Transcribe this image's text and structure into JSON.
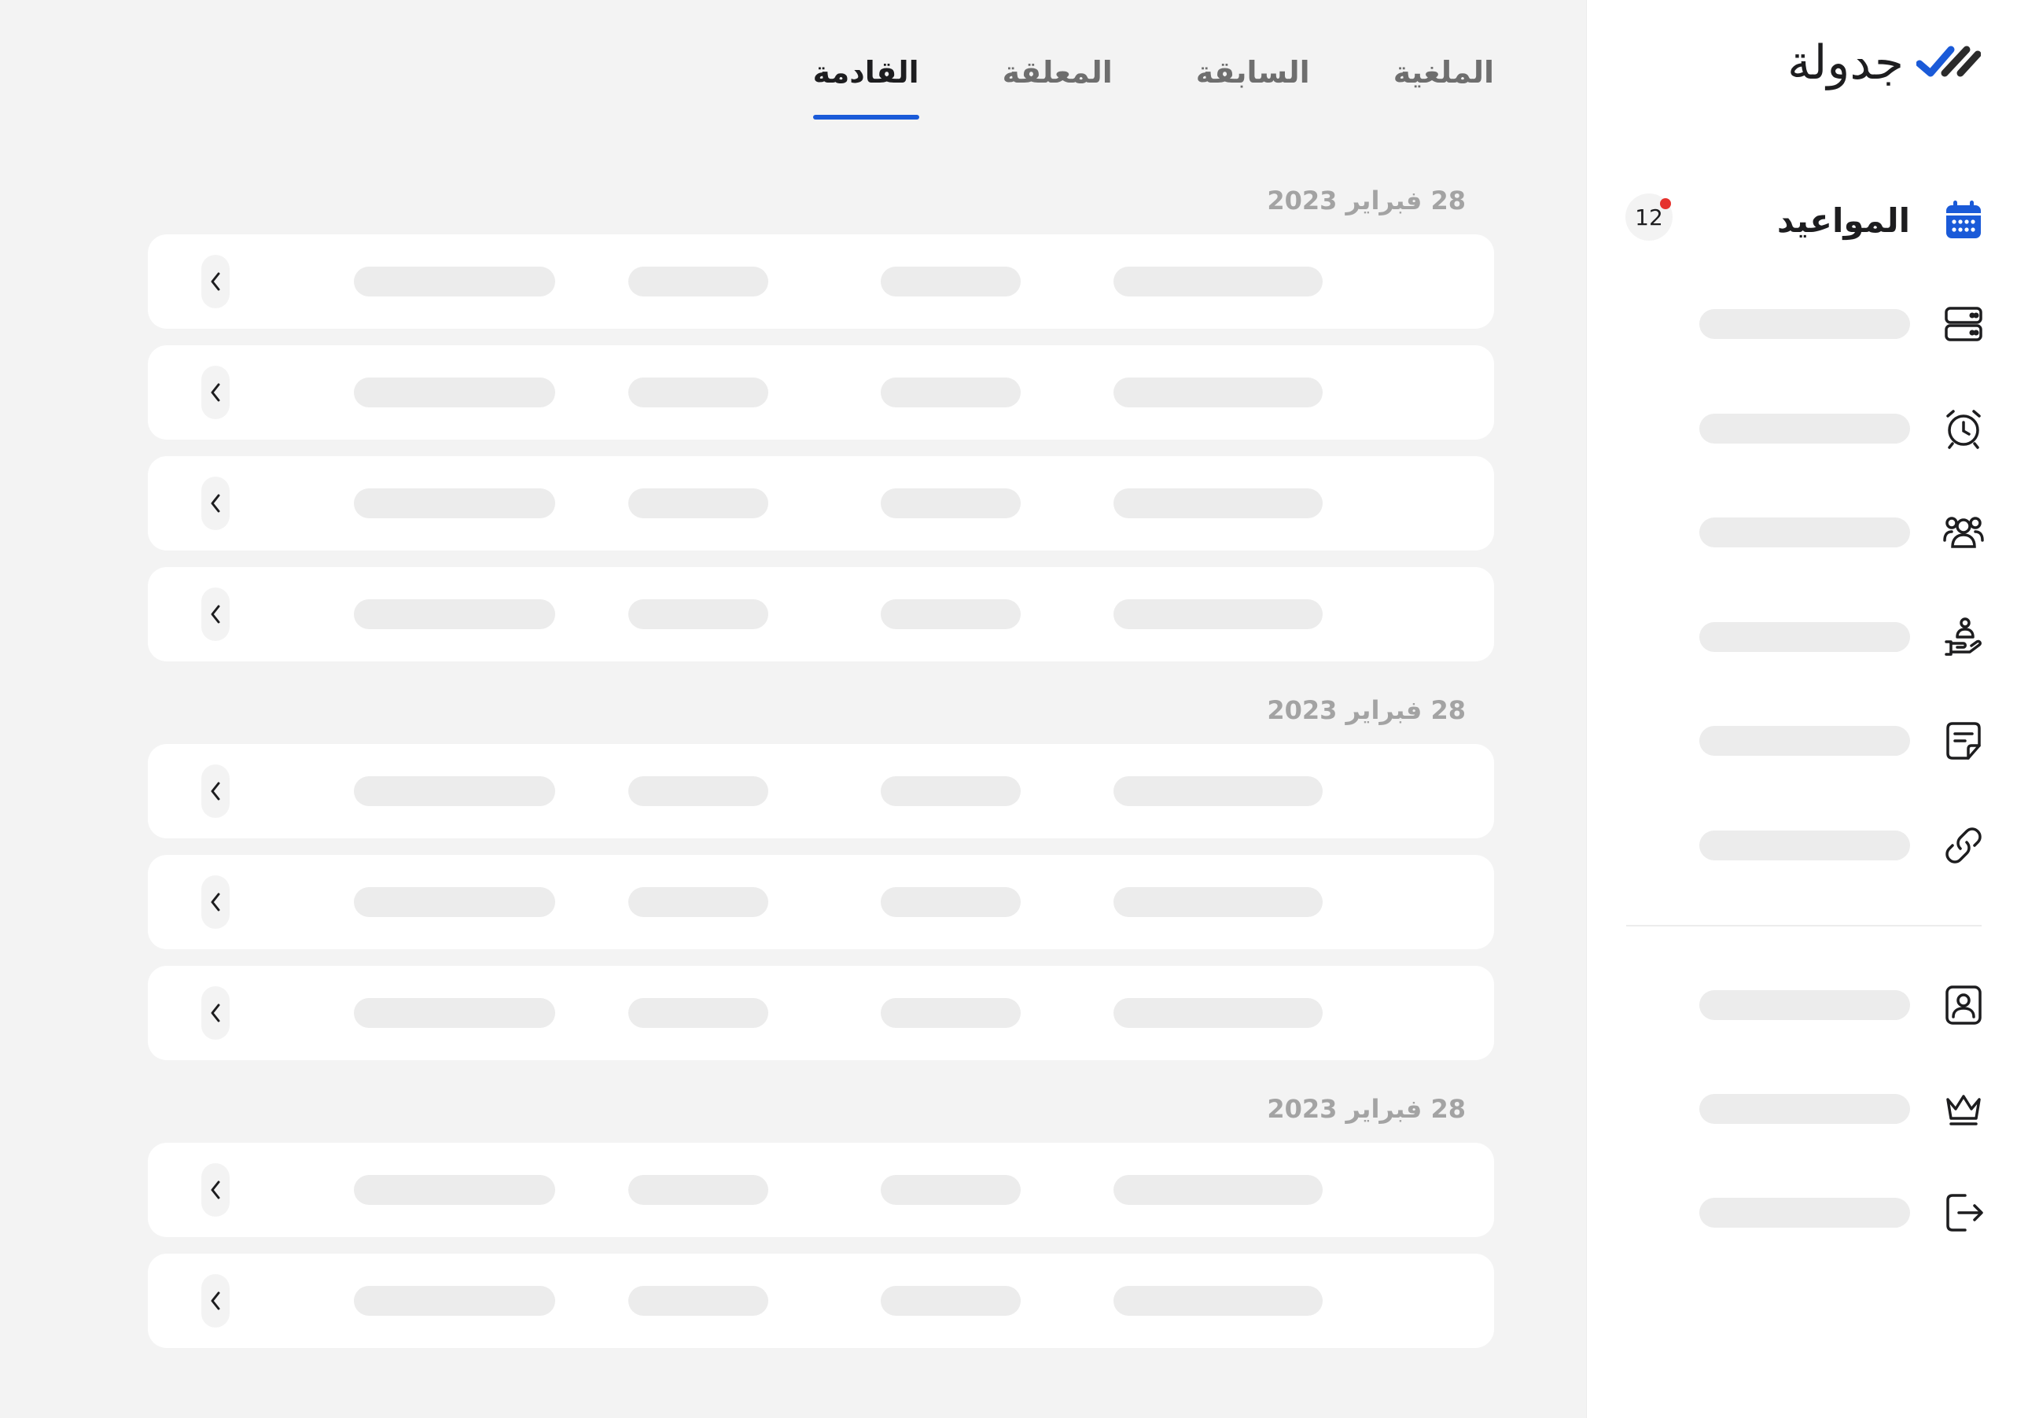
{
  "app": {
    "logo_text": "جدولة",
    "brand_color": "#1a5ad8"
  },
  "tabs": [
    {
      "label": "القادمة",
      "active": true
    },
    {
      "label": "المعلقة",
      "active": false
    },
    {
      "label": "السابقة",
      "active": false
    },
    {
      "label": "الملغية",
      "active": false
    }
  ],
  "sidebar": {
    "active_item": {
      "label": "المواعيد",
      "icon": "calendar-icon",
      "badge_count": "12"
    },
    "items": [
      {
        "icon": "server-icon"
      },
      {
        "icon": "alarm-clock-icon"
      },
      {
        "icon": "users-icon"
      },
      {
        "icon": "service-hand-icon"
      },
      {
        "icon": "note-icon"
      },
      {
        "icon": "link-icon"
      },
      {
        "icon": "profile-icon"
      },
      {
        "icon": "crown-icon"
      },
      {
        "icon": "logout-icon"
      }
    ]
  },
  "groups": [
    {
      "date": "28 فبراير 2023",
      "rows": 4
    },
    {
      "date": "28 فبراير 2023",
      "rows": 3
    },
    {
      "date": "28 فبراير 2023",
      "rows": 2
    }
  ]
}
